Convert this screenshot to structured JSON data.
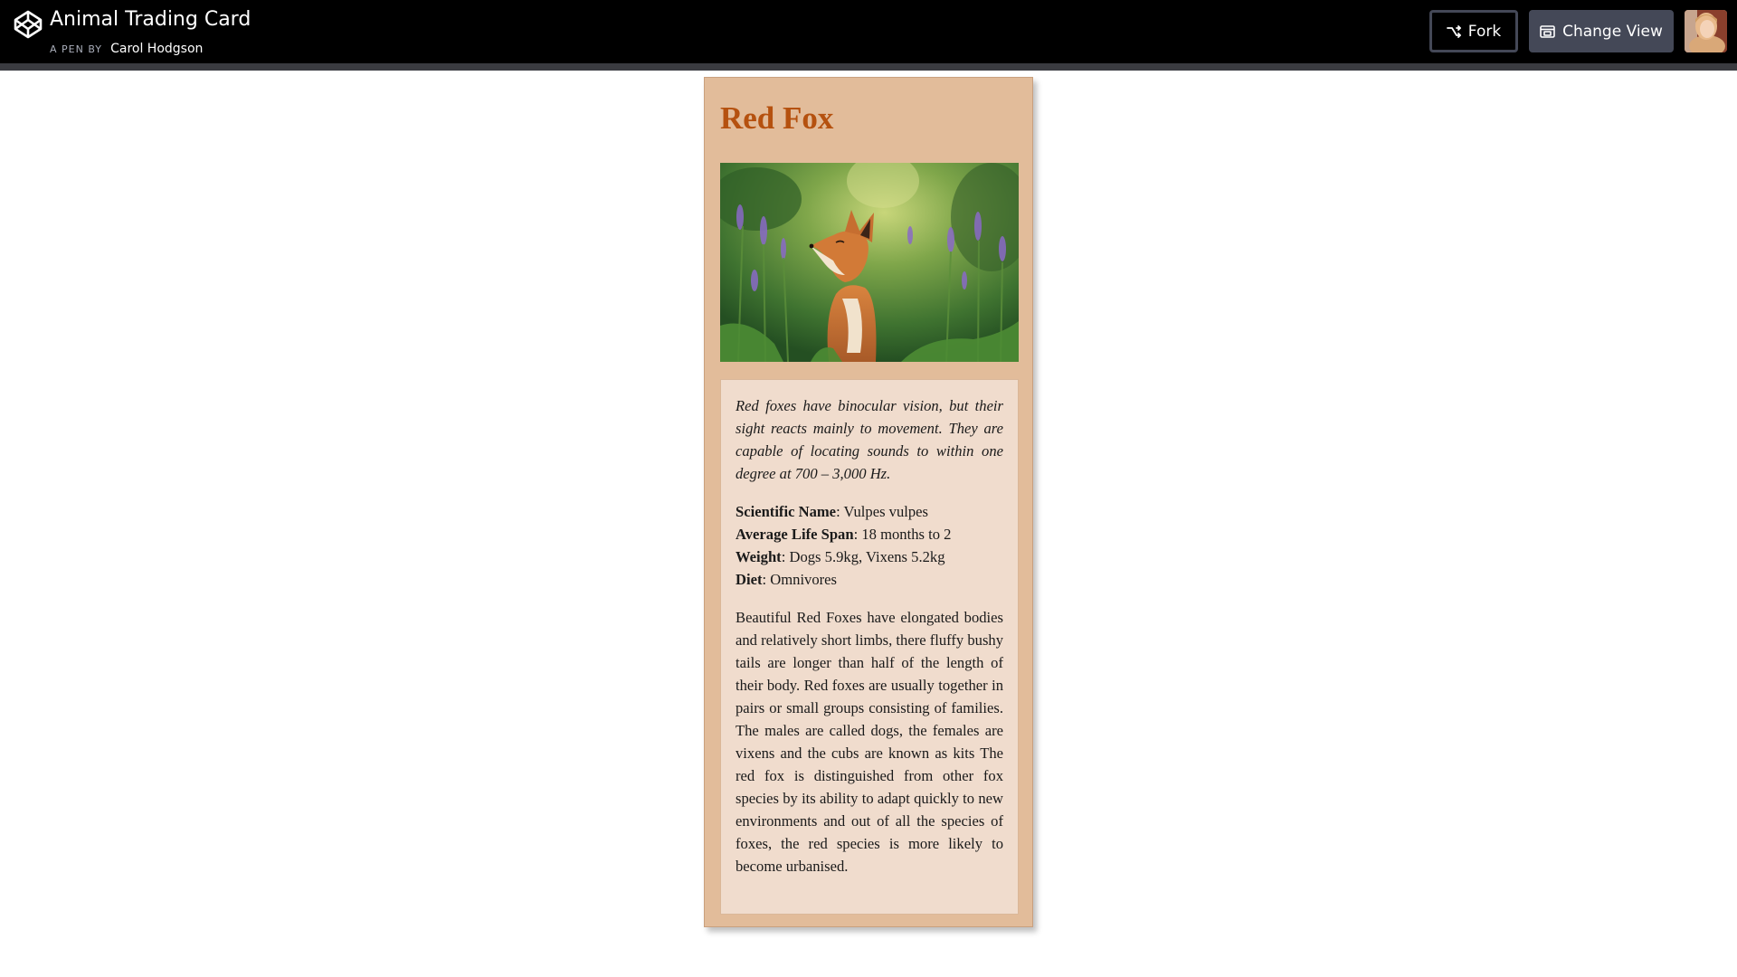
{
  "header": {
    "title": "Animal Trading Card",
    "byline_prefix": "A PEN BY",
    "author": "Carol Hodgson",
    "fork_label": "Fork",
    "change_view_label": "Change View"
  },
  "card": {
    "title": "Red Fox",
    "intro": "Red foxes have binocular vision, but their sight reacts mainly to movement. They are capable of locating sounds to within one degree at 700 – 3,000 Hz.",
    "facts": [
      {
        "label": "Scientific Name",
        "value": ": Vulpes vulpes"
      },
      {
        "label": "Average Life Span",
        "value": ": 18 months to 2"
      },
      {
        "label": "Weight",
        "value": ": Dogs 5.9kg, Vixens 5.2kg"
      },
      {
        "label": "Diet",
        "value": ": Omnivores"
      }
    ],
    "description": "Beautiful Red Foxes have elongated bodies and relatively short limbs, there fluffy bushy tails are longer than half of the length of their body. Red foxes are usually together in pairs or small groups consisting of families. The males are called dogs, the females are vixens and the cubs are known as kits The red fox is distinguished from other fox species by its ability to adapt quickly to new environments and out of all the species of foxes, the red species is more likely to become urbanised."
  },
  "colors": {
    "topbar": "#000000",
    "card_background": "#e2bc9a",
    "card_body_background": "#f0dccd",
    "title_color": "#b5510f"
  },
  "icons": {
    "logo": "codepen-logo-icon",
    "fork": "fork-icon",
    "change_view": "layout-icon"
  }
}
